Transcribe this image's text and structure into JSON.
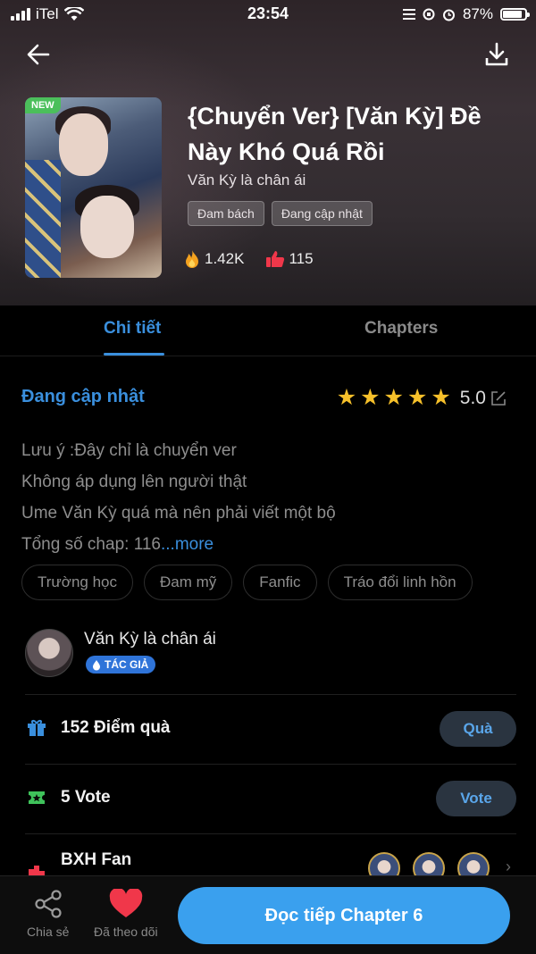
{
  "status_bar": {
    "carrier": "iTel",
    "time": "23:54",
    "battery": "87%"
  },
  "header": {
    "new_badge": "NEW",
    "title": "{Chuyển Ver} [Văn Kỳ] Đề Này Khó Quá Rồi",
    "author": "Văn Kỳ là chân ái",
    "tags": [
      "Đam bách",
      "Đang cập nhật"
    ],
    "views": "1.42K",
    "likes": "115"
  },
  "tabs": [
    {
      "label": "Chi tiết",
      "active": true
    },
    {
      "label": "Chapters",
      "active": false
    }
  ],
  "detail": {
    "status": "Đang cập nhật",
    "rating": "5.0",
    "stars": 5,
    "description_lines": [
      "Lưu ý :Đây chỉ là chuyển ver",
      "Không áp dụng lên người thật",
      "Ume Văn Kỳ quá mà nên phải viết một bộ",
      "Tổng số chap: 116"
    ],
    "more_label": "...more",
    "genres": [
      "Trường học",
      "Đam mỹ",
      "Fanfic",
      "Tráo đổi linh hồn"
    ]
  },
  "author_block": {
    "name": "Văn Kỳ là chân ái",
    "badge": "TÁC GIẢ"
  },
  "gift_row": {
    "label": "152 Điểm quà",
    "button": "Quà"
  },
  "vote_row": {
    "label": "5 Vote",
    "button": "Vote"
  },
  "fan_row": {
    "label": "BXH Fan"
  },
  "bottom_bar": {
    "share_label": "Chia sẻ",
    "follow_label": "Đã theo dõi",
    "read_button": "Đọc tiếp Chapter 6"
  },
  "colors": {
    "accent": "#3a8fdd",
    "button_blue": "#3aa0ee",
    "star": "#f6c02a",
    "new_badge": "#4bbf5b",
    "heart": "#f0374a"
  }
}
